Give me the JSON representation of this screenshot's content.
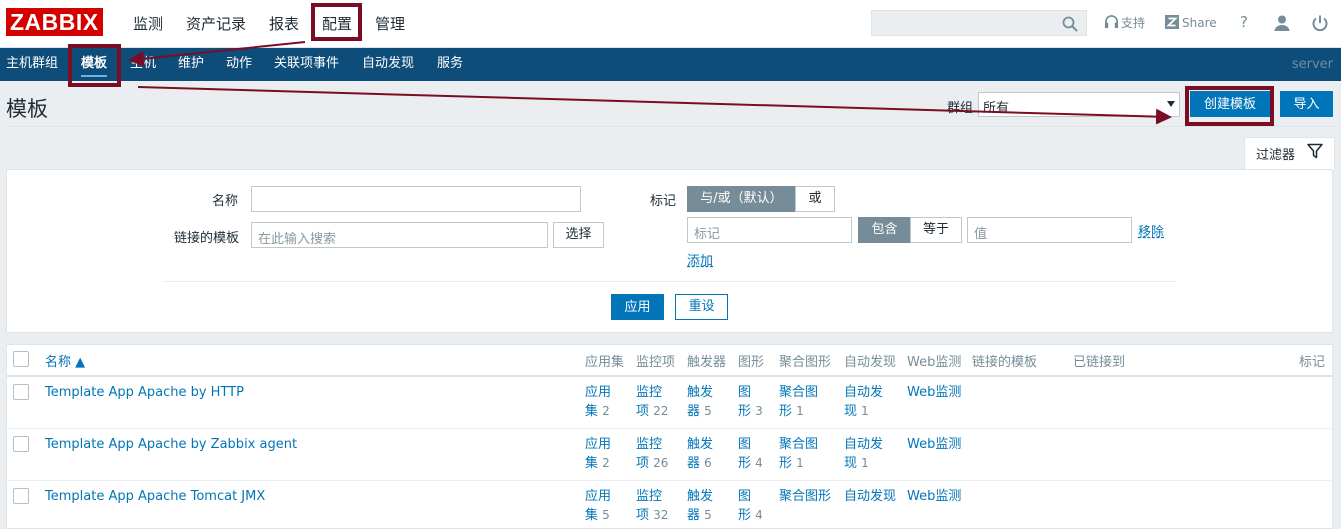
{
  "header": {
    "logo": "ZABBIX",
    "nav": [
      "监测",
      "资产记录",
      "报表",
      "配置",
      "管理"
    ],
    "active_nav": "配置",
    "support_label": "支持",
    "share_label": "Share",
    "help_label": "?"
  },
  "subnav": {
    "items": [
      "主机群组",
      "模板",
      "主机",
      "维护",
      "动作",
      "关联项事件",
      "自动发现",
      "服务"
    ],
    "active": "模板",
    "server_label": "server"
  },
  "page": {
    "title": "模板",
    "group_label": "群组",
    "group_value": "所有",
    "create_button": "创建模板",
    "import_button": "导入"
  },
  "filter": {
    "tab_label": "过滤器",
    "name_label": "名称",
    "name_value": "",
    "linked_label": "链接的模板",
    "linked_placeholder": "在此输入搜索",
    "select_button": "选择",
    "tags_label": "标记",
    "and_or_label": "与/或（默认）",
    "or_label": "或",
    "tag_placeholder": "标记",
    "contains_label": "包含",
    "equals_label": "等于",
    "value_placeholder": "值",
    "remove_link": "移除",
    "add_link": "添加",
    "apply_button": "应用",
    "reset_button": "重设"
  },
  "table": {
    "columns": [
      "名称 ▲",
      "应用集",
      "监控项",
      "触发器",
      "图形",
      "聚合图形",
      "自动发现",
      "Web监测",
      "链接的模板",
      "已链接到",
      "标记"
    ],
    "rows": [
      {
        "name": "Template App Apache by HTTP",
        "apps_l1": "应用",
        "apps_l2": "集",
        "apps_count": "2",
        "items_l1": "监控",
        "items_l2": "项",
        "items_count": "22",
        "triggers_l1": "触发",
        "triggers_l2": "器",
        "triggers_count": "5",
        "graphs_l1": "图",
        "graphs_l2": "形",
        "graphs_count": "3",
        "screens_l1": "聚合图",
        "screens_l2": "形",
        "screens_count": "1",
        "discovery_l1": "自动发",
        "discovery_l2": "现",
        "discovery_count": "1",
        "web": "Web监测"
      },
      {
        "name": "Template App Apache by Zabbix agent",
        "apps_l1": "应用",
        "apps_l2": "集",
        "apps_count": "2",
        "items_l1": "监控",
        "items_l2": "项",
        "items_count": "26",
        "triggers_l1": "触发",
        "triggers_l2": "器",
        "triggers_count": "6",
        "graphs_l1": "图",
        "graphs_l2": "形",
        "graphs_count": "4",
        "screens_l1": "聚合图",
        "screens_l2": "形",
        "screens_count": "1",
        "discovery_l1": "自动发",
        "discovery_l2": "现",
        "discovery_count": "1",
        "web": "Web监测"
      },
      {
        "name": "Template App Apache Tomcat JMX",
        "apps_l1": "应用",
        "apps_l2": "集",
        "apps_count": "5",
        "items_l1": "监控",
        "items_l2": "项",
        "items_count": "32",
        "triggers_l1": "触发",
        "triggers_l2": "器",
        "triggers_count": "5",
        "graphs_l1": "图",
        "graphs_l2": "形",
        "graphs_count": "4",
        "screens": "聚合图形",
        "discovery": "自动发现",
        "web": "Web监测"
      }
    ]
  },
  "colors": {
    "brand_red": "#d40000",
    "subnav_blue": "#0e4c79",
    "link_blue": "#0275b8",
    "annotation": "#7a0d24"
  }
}
